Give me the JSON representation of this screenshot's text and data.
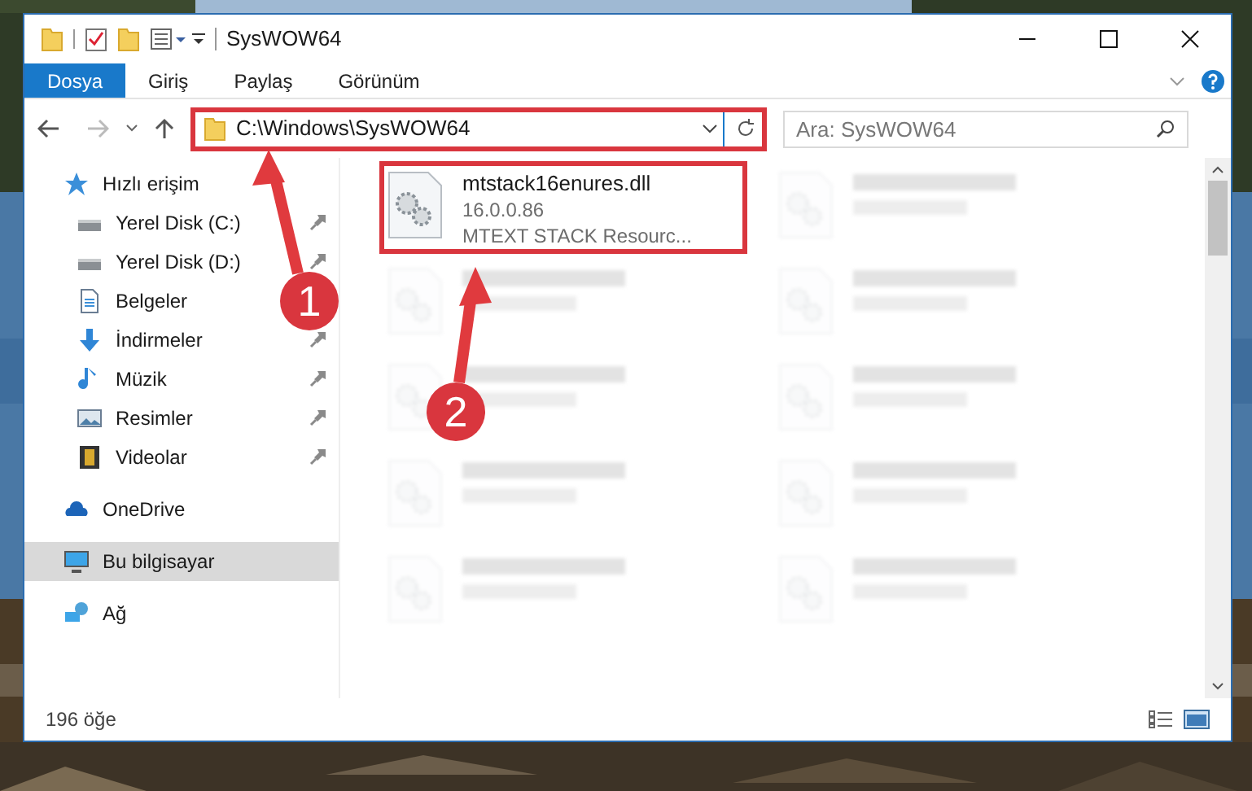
{
  "window": {
    "title": "SysWOW64"
  },
  "ribbon_tabs": [
    {
      "label": "Dosya",
      "selected": true
    },
    {
      "label": "Giriş",
      "selected": false
    },
    {
      "label": "Paylaş",
      "selected": false
    },
    {
      "label": "Görünüm",
      "selected": false
    }
  ],
  "address": {
    "path": "C:\\Windows\\SysWOW64"
  },
  "search": {
    "placeholder": "Ara: SysWOW64"
  },
  "sidebar": {
    "items": [
      {
        "label": "Hızlı erişim",
        "kind": "star",
        "selected": false,
        "children": [
          {
            "label": "Yerel Disk (C:)",
            "kind": "drive",
            "pinned": true,
            "selected": false
          },
          {
            "label": "Yerel Disk (D:)",
            "kind": "drive",
            "pinned": true,
            "selected": false
          },
          {
            "label": "Belgeler",
            "kind": "document",
            "selected": false
          },
          {
            "label": "İndirmeler",
            "kind": "download",
            "pinned": true,
            "selected": false
          },
          {
            "label": "Müzik",
            "kind": "music",
            "pinned": true,
            "selected": false
          },
          {
            "label": "Resimler",
            "kind": "pictures",
            "pinned": true,
            "selected": false
          },
          {
            "label": "Videolar",
            "kind": "video",
            "pinned": true,
            "selected": false
          }
        ]
      },
      {
        "label": "OneDrive",
        "kind": "cloud",
        "selected": false
      },
      {
        "label": "Bu bilgisayar",
        "kind": "computer",
        "selected": true
      },
      {
        "label": "Ağ",
        "kind": "network",
        "selected": false
      }
    ]
  },
  "files": [
    {
      "name": "mtstack16enures.dll",
      "version": "16.0.0.86",
      "description": "MTEXT STACK Resourc...",
      "highlighted": true
    },
    {
      "highlighted": false
    },
    {
      "highlighted": false
    },
    {
      "highlighted": false
    },
    {
      "highlighted": false
    },
    {
      "highlighted": false
    },
    {
      "highlighted": false
    },
    {
      "highlighted": false
    },
    {
      "highlighted": false
    },
    {
      "highlighted": false
    }
  ],
  "annotations": [
    {
      "number": "1"
    },
    {
      "number": "2"
    }
  ],
  "status_bar": {
    "count": "196 öğe"
  }
}
